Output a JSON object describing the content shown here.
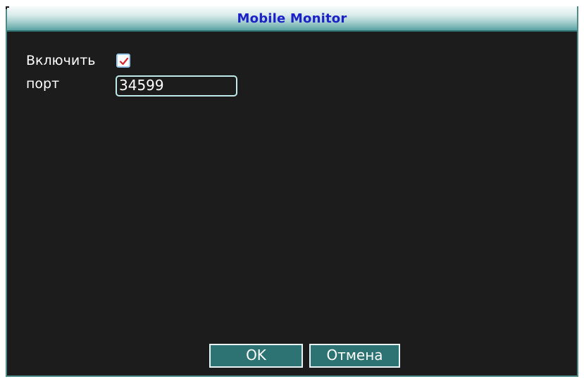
{
  "window": {
    "title": "Mobile Monitor"
  },
  "form": {
    "enable_label": "Включить",
    "enable_checked": true,
    "port_label": "порт",
    "port_value": "34599"
  },
  "buttons": {
    "ok_label": "OK",
    "cancel_label": "Отмена"
  },
  "icons": {
    "check": "checkmark-icon"
  },
  "colors": {
    "title_text": "#1d22c8",
    "panel_bg": "#1c1c1c",
    "accent": "#2d7373",
    "check_mark": "#d9262b"
  }
}
